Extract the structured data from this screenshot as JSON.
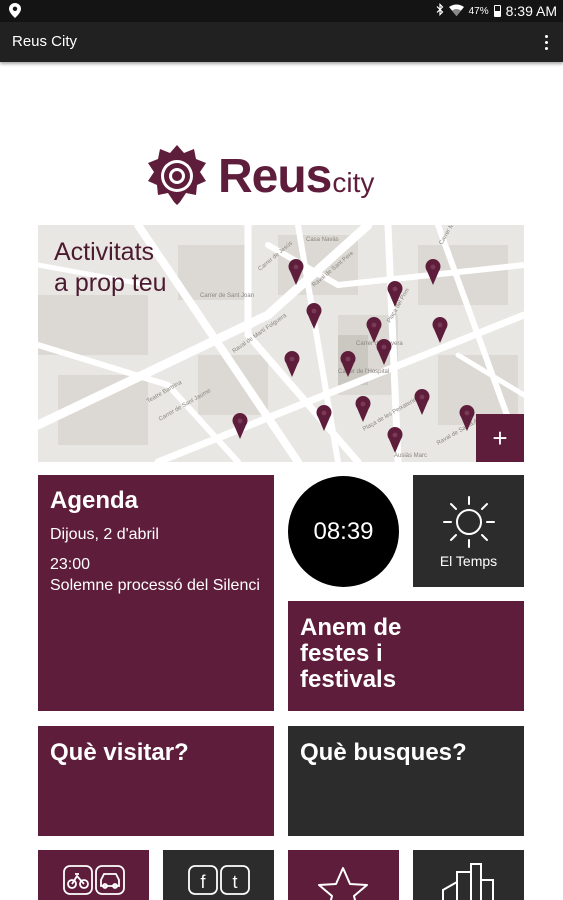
{
  "status_bar": {
    "location_icon": "location-pin-icon",
    "bluetooth_icon": "bluetooth-icon",
    "wifi_icon": "wifi-icon",
    "battery_percent": "47%",
    "battery_level": 0.47,
    "time": "8:39 AM"
  },
  "action_bar": {
    "title": "Reus City",
    "menu_icon": "overflow-menu-icon"
  },
  "logo": {
    "brand": "Reus",
    "suffix": "city",
    "emblem_icon": "rose-emblem-icon"
  },
  "map": {
    "title_line1": "Activitats",
    "title_line2": "a prop teu",
    "add_label": "+",
    "pin_icon": "map-pin-icon",
    "street_labels": [
      "Casa Navàs",
      "Carrer de Jesús",
      "Raval de Sant Pere",
      "Carrer de Sant Joan",
      "Plaça del Prim",
      "Raval de Martí Folguera",
      "Carrer de l'Hospital",
      "Teatre Bartrina",
      "Carrer de Llovera",
      "Raval de Santa Anna",
      "Carrer de Sant Jaume",
      "Plaça de les Peixateries",
      "Ausiàs Marc",
      "Carrer Major"
    ],
    "colors": {
      "pin": "#5e1d3a",
      "accent": "#5e1d3a"
    }
  },
  "agenda": {
    "title": "Agenda",
    "date": "Dijous, 2 d'abril",
    "time": "23:00",
    "event": "Solemne processó del Silenci"
  },
  "clock": {
    "time": "08:39"
  },
  "weather": {
    "label": "El Temps",
    "icon": "sun-icon"
  },
  "festes": {
    "line1": "Anem de",
    "line2": "festes i",
    "line3": "festivals"
  },
  "visitar": {
    "title": "Què visitar?"
  },
  "busques": {
    "title": "Què busques?"
  },
  "bottom_tiles": [
    {
      "icon": "transport-icon"
    },
    {
      "icon": "social-media-icon"
    },
    {
      "icon": "star-icon"
    },
    {
      "icon": "city-buildings-icon"
    }
  ],
  "colors": {
    "maroon": "#5e1d3a",
    "dark_tile": "#2c2c2c",
    "clock": "#000000"
  }
}
